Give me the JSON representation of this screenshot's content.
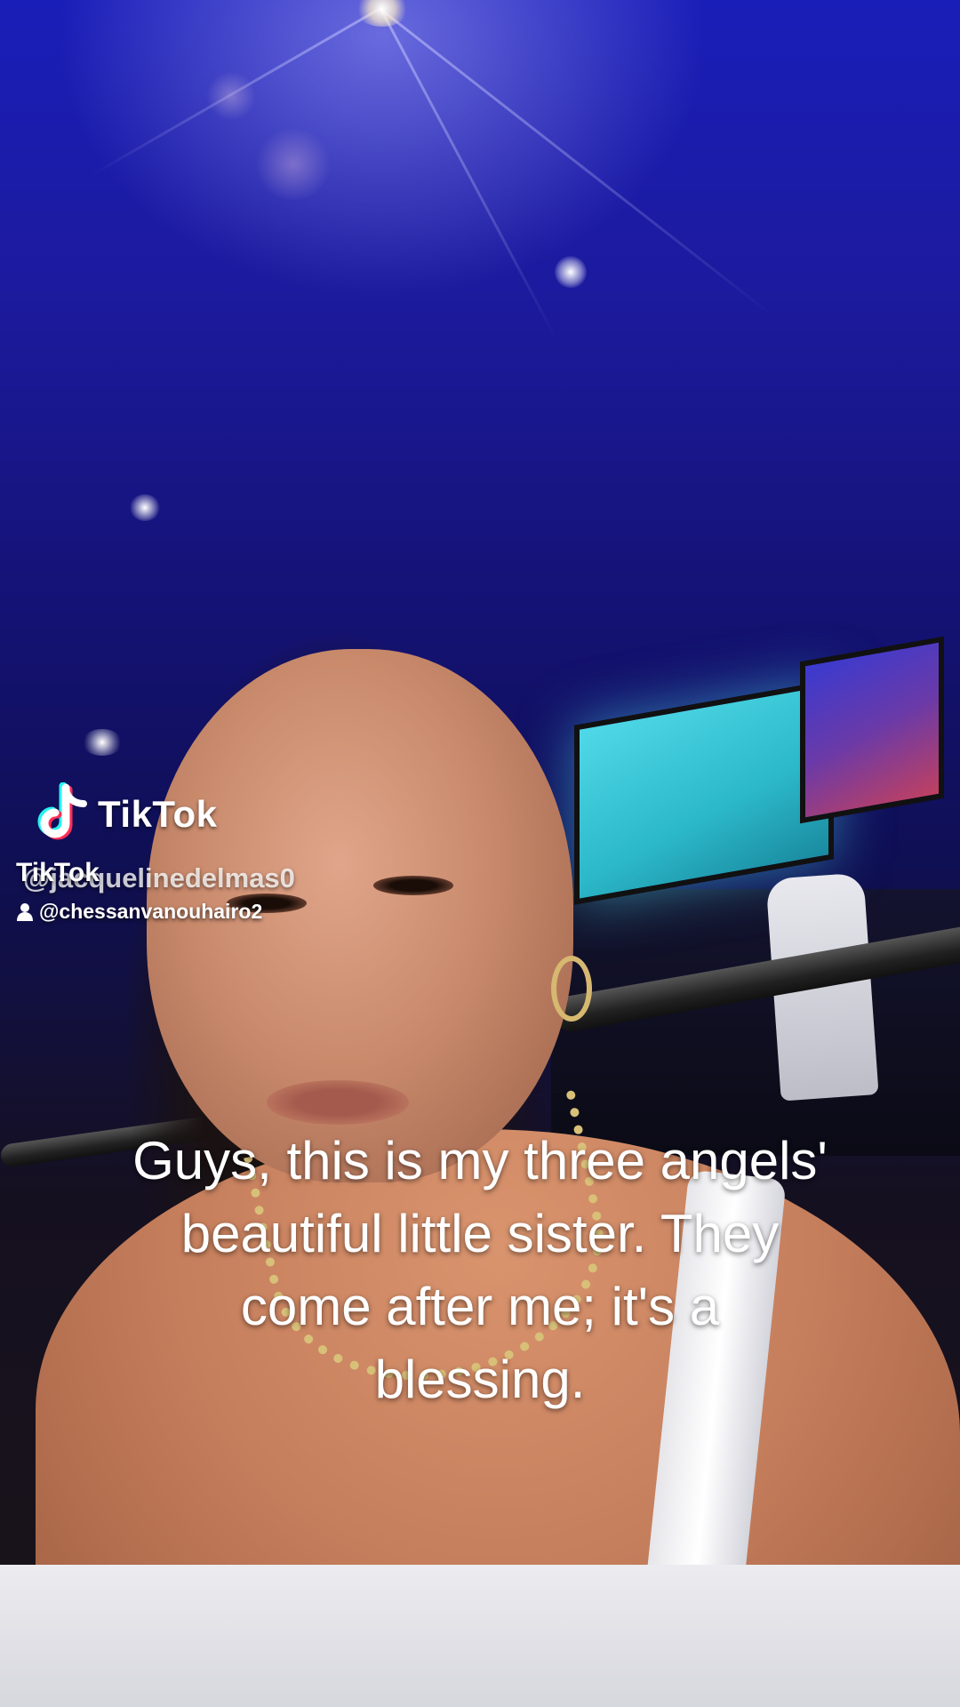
{
  "watermark": {
    "brand": "TikTok",
    "brand_small": "TikTok",
    "creator_handle": "@jacquelinedelmas0",
    "original_sound_handle": "@chessanvanouhairo2",
    "icons": {
      "logo": "tiktok-logo-icon",
      "person": "person-icon"
    }
  },
  "caption": {
    "lines": [
      "Guys, this is my three angels'",
      "beautiful little sister. They",
      "come after me; it's a",
      "blessing."
    ]
  },
  "colors": {
    "tiktok_cyan": "#25F4EE",
    "tiktok_red": "#FE2C55",
    "caption_text": "#FFFFFF"
  }
}
